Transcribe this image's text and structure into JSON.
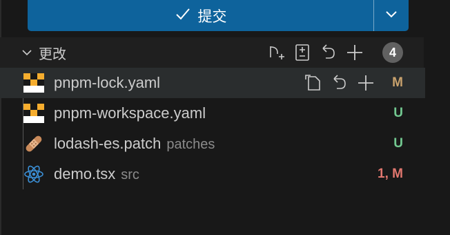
{
  "commit_button": {
    "label": "提交",
    "check_icon": "check-icon",
    "dropdown_icon": "chevron-down-icon"
  },
  "changes_section": {
    "title": "更改",
    "count": "4",
    "actions": [
      "git-pull-request-icon",
      "open-changes-icon",
      "discard-all-icon",
      "stage-all-icon"
    ]
  },
  "files": [
    {
      "name": "pnpm-lock.yaml",
      "dir": "",
      "status": "M",
      "status_color": "#c9a26d",
      "icon": "yaml-file-icon",
      "selected": true
    },
    {
      "name": "pnpm-workspace.yaml",
      "dir": "",
      "status": "U",
      "status_color": "#73c991",
      "icon": "yaml-file-icon",
      "selected": false
    },
    {
      "name": "lodash-es.patch",
      "dir": "patches",
      "status": "U",
      "status_color": "#73c991",
      "icon": "patch-file-icon",
      "selected": false
    },
    {
      "name": "demo.tsx",
      "dir": "src",
      "status": "1, M",
      "status_color": "#e2776f",
      "icon": "react-file-icon",
      "selected": false
    }
  ],
  "row_actions": [
    "open-file-icon",
    "discard-changes-icon",
    "stage-changes-icon"
  ],
  "colors": {
    "accent": "#0e639c",
    "background": "#181818",
    "selection": "#2a2d2e"
  }
}
